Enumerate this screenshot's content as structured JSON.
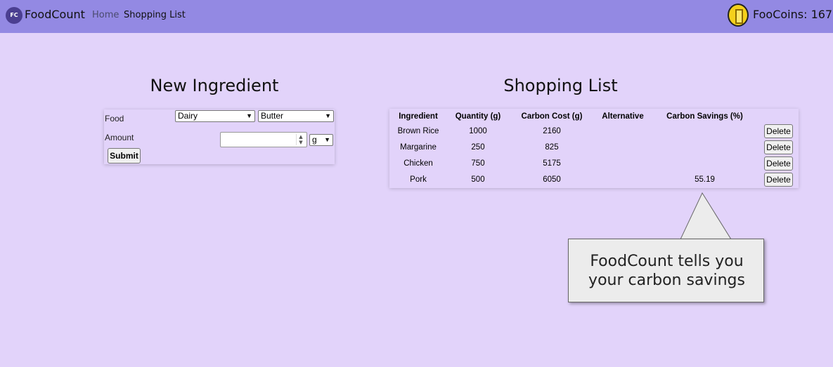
{
  "nav": {
    "brand_logo_text": "FC",
    "brand_name": "FoodCount",
    "links": [
      "Home",
      "Shopping List"
    ],
    "coins_label": "FooCoins: 167"
  },
  "ingredient_form": {
    "title": "New Ingredient",
    "food_label": "Food",
    "category_value": "Dairy",
    "food_value": "Butter",
    "amount_label": "Amount",
    "amount_value": "",
    "unit_value": "g",
    "submit_label": "Submit"
  },
  "shopping_list": {
    "title": "Shopping List",
    "columns": [
      "Ingredient",
      "Quantity (g)",
      "Carbon Cost (g)",
      "Alternative",
      "Carbon Savings (%)",
      ""
    ],
    "rows": [
      {
        "ingredient": "Brown Rice",
        "quantity": "1000",
        "carbon_cost": "2160",
        "alternative": "",
        "savings": ""
      },
      {
        "ingredient": "Margarine",
        "quantity": "250",
        "carbon_cost": "825",
        "alternative": "",
        "savings": ""
      },
      {
        "ingredient": "Chicken",
        "quantity": "750",
        "carbon_cost": "5175",
        "alternative": "",
        "savings": ""
      },
      {
        "ingredient": "Pork",
        "quantity": "500",
        "carbon_cost": "6050",
        "alternative": "",
        "savings": "55.19"
      }
    ],
    "delete_label": "Delete"
  },
  "callout": {
    "line1": "FoodCount tells you",
    "line2": "your carbon savings"
  }
}
